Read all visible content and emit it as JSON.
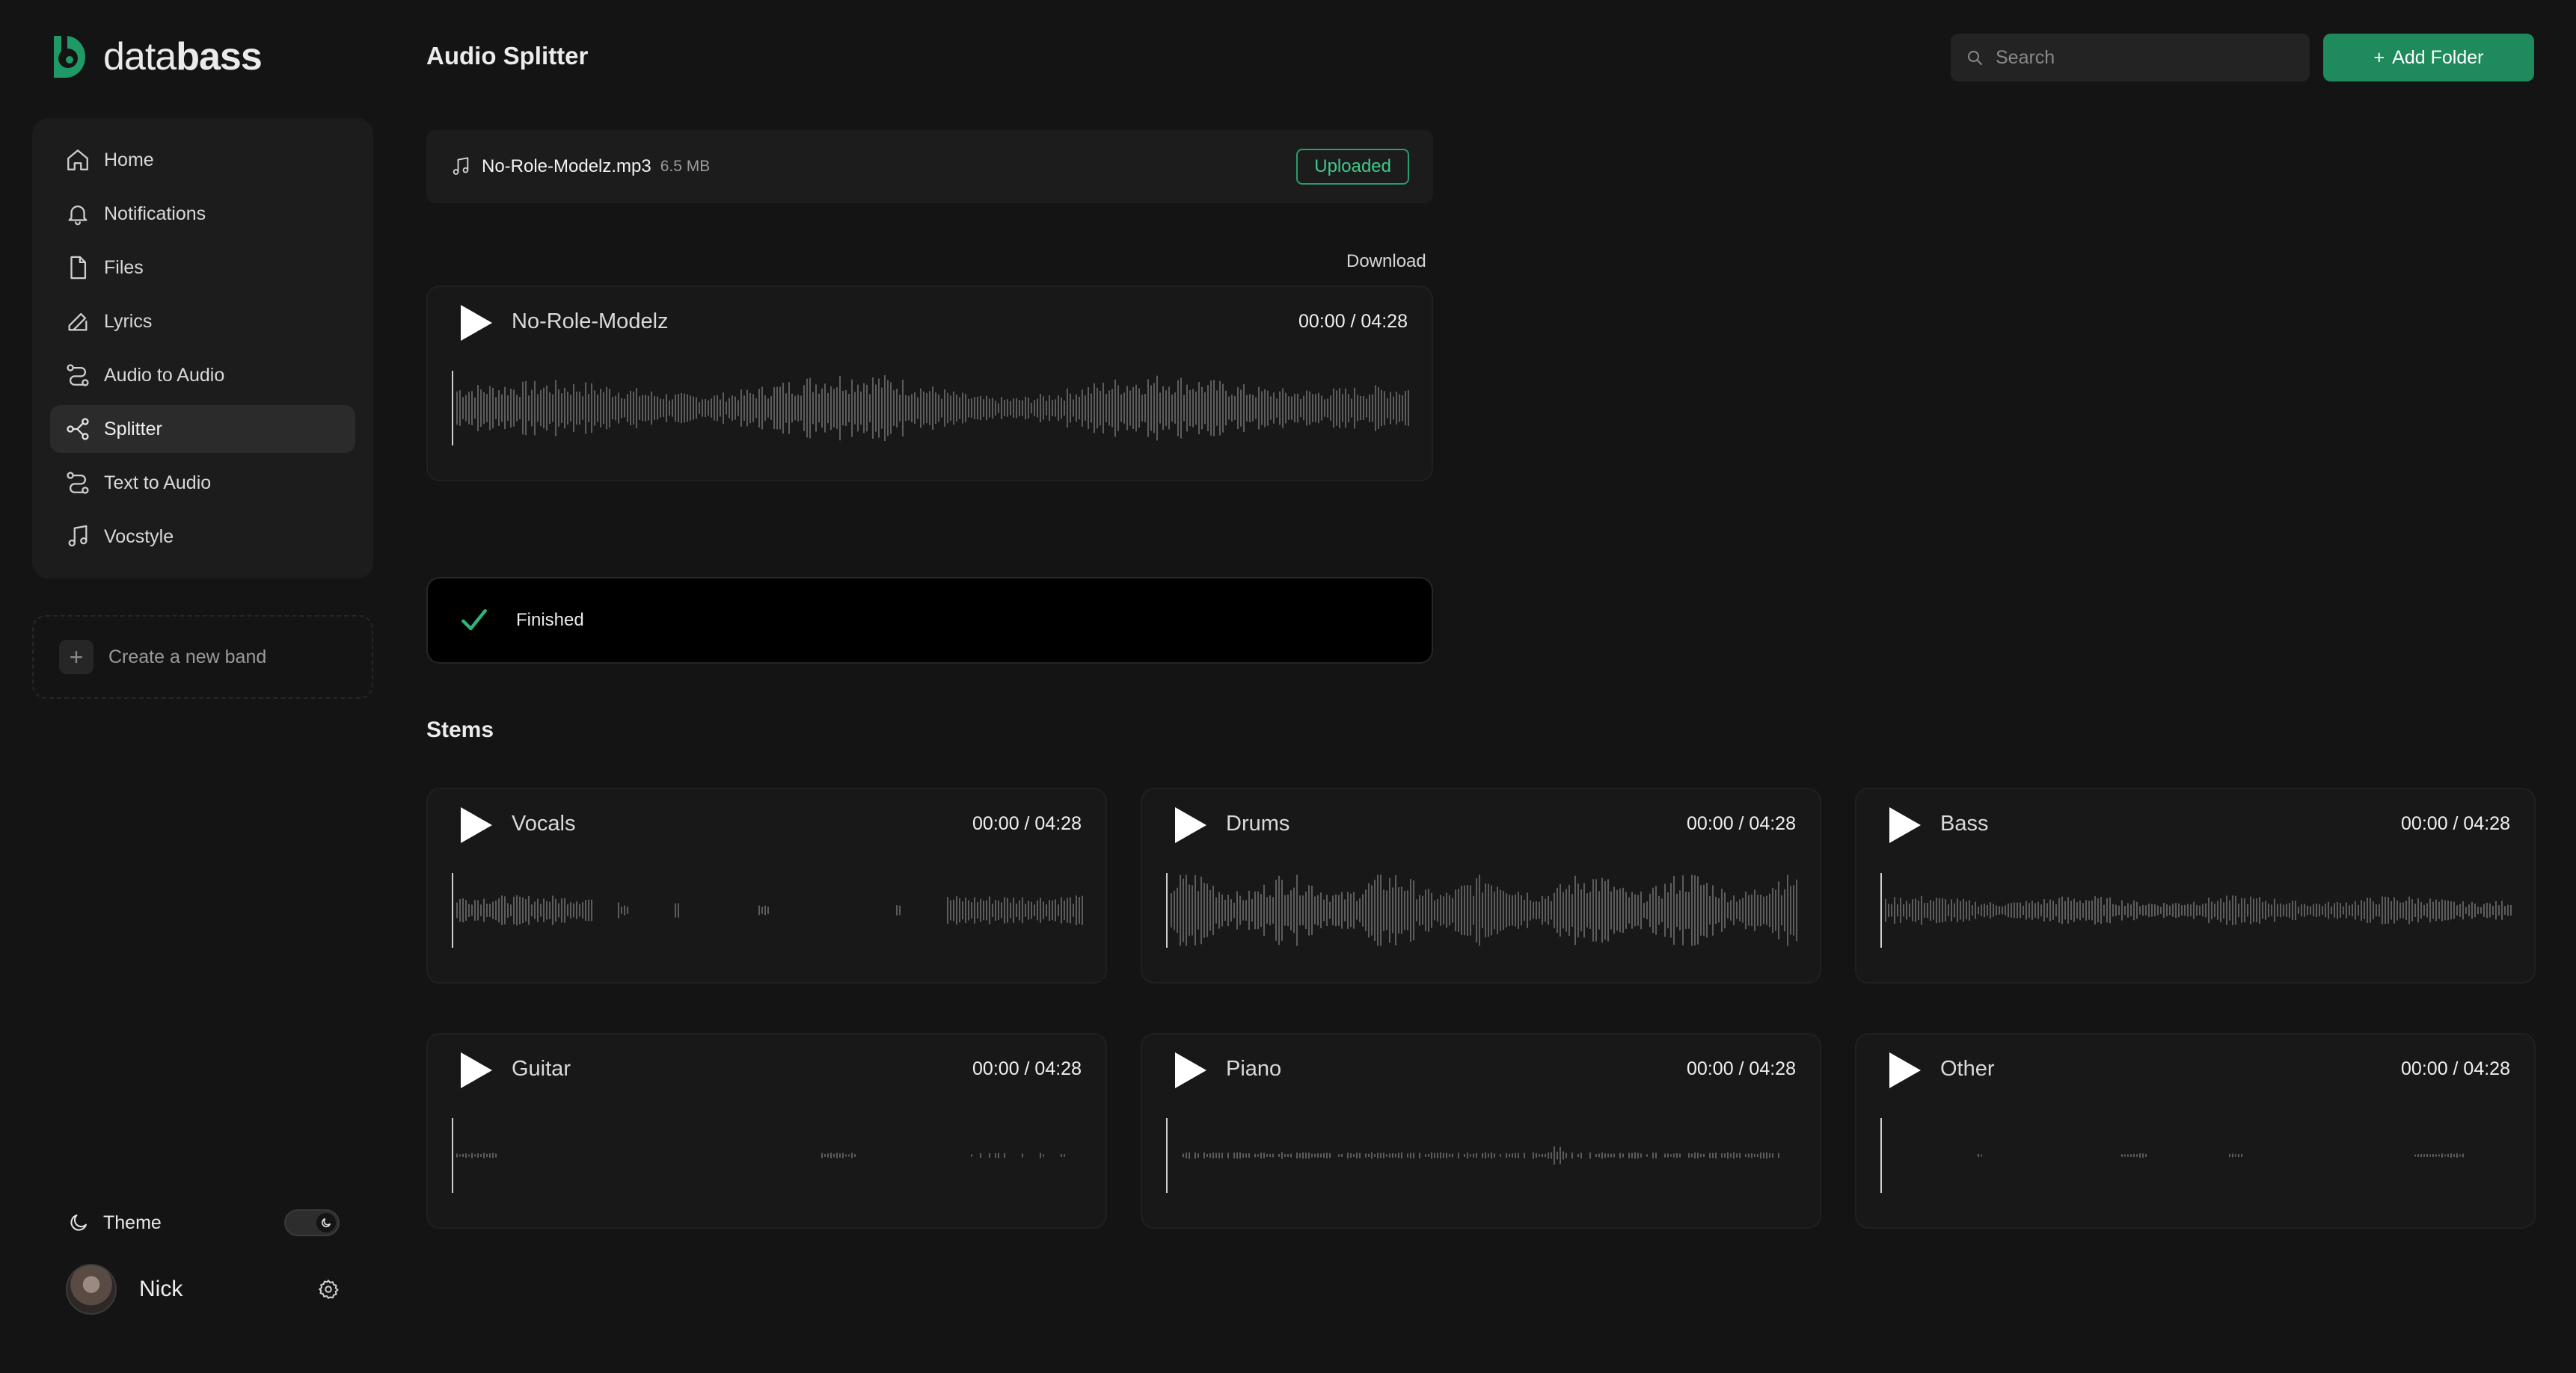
{
  "logo": {
    "prefix": "data",
    "suffix": "bass"
  },
  "sidebar": {
    "items": [
      {
        "label": "Home",
        "icon": "home-icon"
      },
      {
        "label": "Notifications",
        "icon": "bell-icon"
      },
      {
        "label": "Files",
        "icon": "file-icon"
      },
      {
        "label": "Lyrics",
        "icon": "pen-icon"
      },
      {
        "label": "Audio to Audio",
        "icon": "route-icon"
      },
      {
        "label": "Splitter",
        "icon": "split-icon",
        "active": true
      },
      {
        "label": "Text to Audio",
        "icon": "route-icon"
      },
      {
        "label": "Vocstyle",
        "icon": "music-note-icon"
      }
    ],
    "create_band": "Create a new band",
    "theme_label": "Theme",
    "user_name": "Nick"
  },
  "header": {
    "title": "Audio Splitter",
    "search_placeholder": "Search",
    "add_folder_label": "Add Folder"
  },
  "file": {
    "name": "No-Role-Modelz.mp3",
    "size": "6.5 MB",
    "status_badge": "Uploaded"
  },
  "main_track": {
    "download_label": "Download",
    "name": "No-Role-Modelz",
    "time": "00:00 / 04:28"
  },
  "status": {
    "text": "Finished"
  },
  "stems_title": "Stems",
  "stems": [
    {
      "name": "Vocals",
      "time": "00:00 / 04:28"
    },
    {
      "name": "Drums",
      "time": "00:00 / 04:28"
    },
    {
      "name": "Bass",
      "time": "00:00 / 04:28"
    },
    {
      "name": "Guitar",
      "time": "00:00 / 04:28"
    },
    {
      "name": "Piano",
      "time": "00:00 / 04:28"
    },
    {
      "name": "Other",
      "time": "00:00 / 04:28"
    }
  ],
  "colors": {
    "accent": "#1f8a5b",
    "accent_text": "#3fc98a",
    "background": "#141414",
    "waveform": "#5c5c5c"
  }
}
